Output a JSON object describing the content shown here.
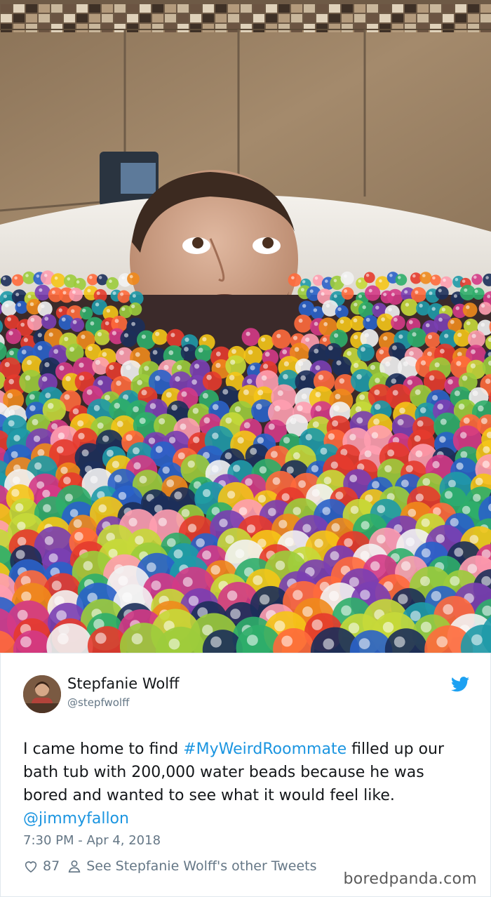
{
  "photo": {
    "description_icon": "bathtub-water-beads-photo"
  },
  "tweet": {
    "author_name": "Stepfanie Wolff",
    "author_handle": "@stepfwolff",
    "text_before": "I came home to find ",
    "hashtag": "#MyWeirdRoommate",
    "text_after": " filled up our bath tub with 200,000 water beads because he was bored and wanted to see what it would feel like. ",
    "mention": "@jimmyfallon",
    "timestamp": "7:30 PM - Apr 4, 2018",
    "like_count": "87",
    "other_tweets_link": "See Stepfanie Wolff's other Tweets",
    "platform_icon": "twitter-bird-icon",
    "link_color": "#1b95e0"
  },
  "watermark": "boredpanda.com"
}
